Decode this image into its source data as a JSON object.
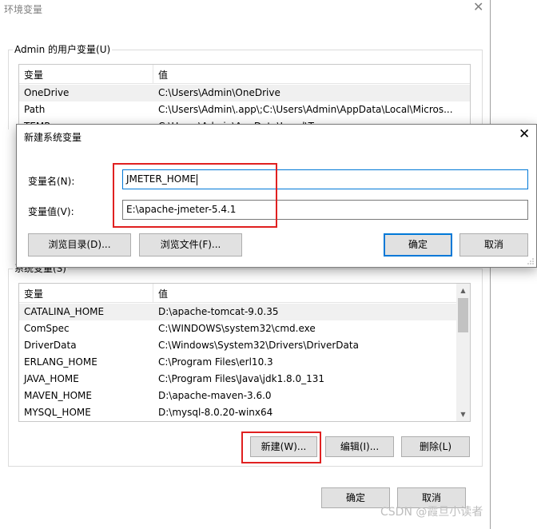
{
  "env_window": {
    "title": "环境变量",
    "user_group_label": "Admin 的用户变量(U)",
    "system_group_label_visible": "系统变量(S)",
    "columns": {
      "var": "变量",
      "val": "值"
    },
    "user_vars": [
      {
        "name": "OneDrive",
        "value": "C:\\Users\\Admin\\OneDrive"
      },
      {
        "name": "Path",
        "value": "C:\\Users\\Admin\\.app\\;C:\\Users\\Admin\\AppData\\Local\\Micros..."
      },
      {
        "name": "TEMP",
        "value": "C:\\Users\\Admin\\AppData\\Local\\Temp"
      }
    ],
    "system_vars": [
      {
        "name": "CATALINA_HOME",
        "value": "D:\\apache-tomcat-9.0.35"
      },
      {
        "name": "ComSpec",
        "value": "C:\\WINDOWS\\system32\\cmd.exe"
      },
      {
        "name": "DriverData",
        "value": "C:\\Windows\\System32\\Drivers\\DriverData"
      },
      {
        "name": "ERLANG_HOME",
        "value": "C:\\Program Files\\erl10.3"
      },
      {
        "name": "JAVA_HOME",
        "value": "C:\\Program Files\\Java\\jdk1.8.0_131"
      },
      {
        "name": "MAVEN_HOME",
        "value": "D:\\apache-maven-3.6.0"
      },
      {
        "name": "MYSQL_HOME",
        "value": "D:\\mysql-8.0.20-winx64"
      }
    ],
    "buttons": {
      "new": "新建(W)...",
      "edit": "编辑(I)...",
      "delete": "删除(L)",
      "ok": "确定",
      "cancel": "取消"
    }
  },
  "modal": {
    "title": "新建系统变量",
    "name_label": "变量名(N):",
    "value_label": "变量值(V):",
    "name_value": "JMETER_HOME",
    "value_value": "E:\\apache-jmeter-5.4.1",
    "browse_dir": "浏览目录(D)...",
    "browse_file": "浏览文件(F)...",
    "ok": "确定",
    "cancel": "取消"
  },
  "watermark": "CSDN @霞旦小读者",
  "colors": {
    "highlight_box": "#e02020",
    "accent": "#0078d7"
  }
}
